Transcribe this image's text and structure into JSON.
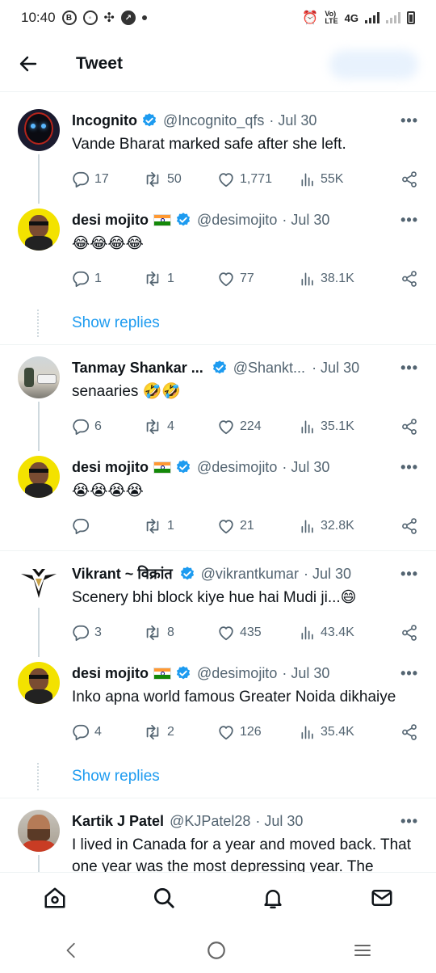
{
  "status_bar": {
    "time": "10:40",
    "network": "4G"
  },
  "header": {
    "title": "Tweet"
  },
  "tweets": [
    {
      "name": "Incognito",
      "handle": "@Incognito_qfs",
      "date": "· Jul 30",
      "text": "Vande Bharat marked safe after she left.",
      "replies": "17",
      "retweets": "50",
      "likes": "1,771",
      "views": "55K"
    },
    {
      "name": "desi mojito",
      "handle": "@desimojito",
      "date": "· Jul 30",
      "text": "😂😂😂😂",
      "replies": "1",
      "retweets": "1",
      "likes": "77",
      "views": "38.1K"
    },
    {
      "name": "Tanmay Shankar ...",
      "handle": "@Shankt...",
      "date": "· Jul 30",
      "text": "senaaries 🤣🤣",
      "replies": "6",
      "retweets": "4",
      "likes": "224",
      "views": "35.1K"
    },
    {
      "name": "desi mojito",
      "handle": "@desimojito",
      "date": "· Jul 30",
      "text": "😭😭😭😭",
      "replies": "",
      "retweets": "1",
      "likes": "21",
      "views": "32.8K"
    },
    {
      "name": "Vikrant ~ विक्रांत",
      "handle": "@vikrantkumar",
      "date": "· Jul 30",
      "text": "Scenery bhi block kiye hue hai Mudi ji...😄",
      "replies": "3",
      "retweets": "8",
      "likes": "435",
      "views": "43.4K"
    },
    {
      "name": "desi mojito",
      "handle": "@desimojito",
      "date": "· Jul 30",
      "text": "Inko apna world famous Greater Noida dikhaiye",
      "replies": "4",
      "retweets": "2",
      "likes": "126",
      "views": "35.4K"
    },
    {
      "name": "Kartik J Patel",
      "handle": "@KJPatel28",
      "date": "· Jul 30",
      "text": "I lived in Canada for a year and moved back. That one year was the most depressing year. The"
    }
  ],
  "show_replies_label": "Show replies",
  "more_label": "•••",
  "colors": {
    "accent": "#1d9bf0",
    "muted": "#536471",
    "text": "#0f1419"
  },
  "icons": [
    "back-arrow-icon",
    "verified-icon",
    "reply-icon",
    "retweet-icon",
    "like-icon",
    "views-icon",
    "share-icon",
    "home-icon",
    "search-icon",
    "notifications-icon",
    "messages-icon"
  ]
}
